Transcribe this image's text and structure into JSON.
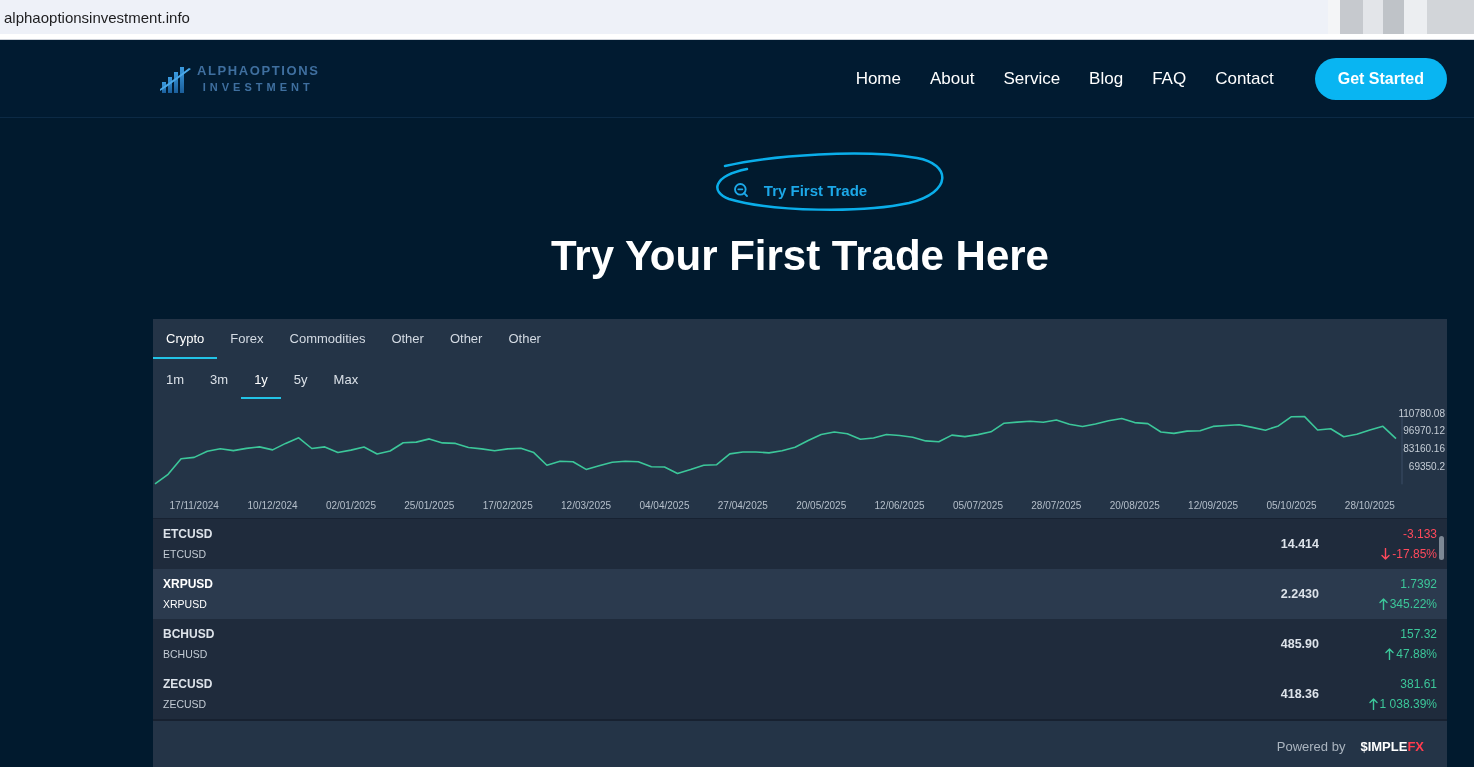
{
  "browser": {
    "url": "alphaoptionsinvestment.info"
  },
  "header": {
    "logo": {
      "line_1": "ALPHAOPTIONS",
      "line_2": "INVESTMENT"
    },
    "nav": [
      "Home",
      "About",
      "Service",
      "Blog",
      "FAQ",
      "Contact"
    ],
    "cta": "Get Started"
  },
  "hero": {
    "tag": "Try First Trade",
    "title": "Try Your First Trade Here"
  },
  "widget": {
    "market_tabs": [
      {
        "label": "Crypto",
        "selected": true
      },
      {
        "label": "Forex",
        "selected": false
      },
      {
        "label": "Commodities",
        "selected": false
      },
      {
        "label": "Other",
        "selected": false
      },
      {
        "label": "Other",
        "selected": false
      },
      {
        "label": "Other",
        "selected": false
      }
    ],
    "period_tabs": [
      {
        "label": "1m",
        "selected": false
      },
      {
        "label": "3m",
        "selected": false
      },
      {
        "label": "1y",
        "selected": true
      },
      {
        "label": "5y",
        "selected": false
      },
      {
        "label": "Max",
        "selected": false
      }
    ],
    "chart_data": {
      "type": "line",
      "categories": [
        null,
        null,
        null,
        "17/11/2024",
        null,
        null,
        null,
        null,
        null,
        "10/12/2024",
        null,
        null,
        null,
        null,
        null,
        "02/01/2025",
        null,
        null,
        null,
        null,
        null,
        "25/01/2025",
        null,
        null,
        null,
        null,
        null,
        "17/02/2025",
        null,
        null,
        null,
        null,
        null,
        "12/03/2025",
        null,
        null,
        null,
        null,
        null,
        "04/04/2025",
        null,
        null,
        null,
        null,
        null,
        "27/04/2025",
        null,
        null,
        null,
        null,
        null,
        "20/05/2025",
        null,
        null,
        null,
        null,
        null,
        "12/06/2025",
        null,
        null,
        null,
        null,
        null,
        "05/07/2025",
        null,
        null,
        null,
        null,
        null,
        "28/07/2025",
        null,
        null,
        null,
        null,
        null,
        "20/08/2025",
        null,
        null,
        null,
        null,
        null,
        "12/09/2025",
        null,
        null,
        null,
        null,
        null,
        "05/10/2025",
        null,
        null,
        null,
        null,
        null,
        "28/10/2025",
        null,
        null
      ],
      "series": [
        {
          "color": "#3cc79a",
          "values": [
            55400,
            62900,
            75000,
            76100,
            80900,
            82900,
            81400,
            83100,
            84300,
            81900,
            87000,
            91400,
            83000,
            84300,
            79900,
            81800,
            84200,
            78700,
            81100,
            87600,
            88000,
            90500,
            87400,
            87000,
            83800,
            82700,
            81300,
            82700,
            83200,
            79800,
            69900,
            73100,
            72700,
            66700,
            69600,
            72300,
            73100,
            72700,
            68700,
            68600,
            63500,
            66500,
            70000,
            70400,
            78800,
            80300,
            80300,
            79600,
            81200,
            84000,
            89300,
            94000,
            95900,
            94600,
            90300,
            91200,
            94000,
            93200,
            91900,
            89000,
            88300,
            93500,
            92300,
            93900,
            96100,
            102800,
            103700,
            104300,
            103600,
            105300,
            102000,
            100200,
            102200,
            104800,
            106500,
            103300,
            102500,
            95900,
            94800,
            96600,
            96900,
            100300,
            101000,
            101600,
            99500,
            97300,
            100700,
            107900,
            108000,
            97500,
            98500,
            92200,
            94200,
            97600,
            100400,
            90800
          ]
        }
      ],
      "ylim": [
        55000,
        110780.08
      ],
      "yticks": [
        110780.08,
        96970.12,
        83160.16,
        69350.2
      ]
    },
    "rows": [
      {
        "kind": "down",
        "title": "ETCUSD",
        "subtitle": "ETCUSD",
        "price": "14.414",
        "change": "-3.133",
        "percent": "-17.85%",
        "selected": false
      },
      {
        "kind": "up",
        "title": "XRPUSD",
        "subtitle": "XRPUSD",
        "price": "2.2430",
        "change": "1.7392",
        "percent": "345.22%",
        "selected": true
      },
      {
        "kind": "up",
        "title": "BCHUSD",
        "subtitle": "BCHUSD",
        "price": "485.90",
        "change": "157.32",
        "percent": "47.88%",
        "selected": false
      },
      {
        "kind": "up",
        "title": "ZECUSD",
        "subtitle": "ZECUSD",
        "price": "418.36",
        "change": "381.61",
        "percent": "1 038.39%",
        "selected": false
      }
    ],
    "footer": {
      "label": "Powered by",
      "brand": "$IMPLE",
      "brand_accent": "FX"
    }
  }
}
